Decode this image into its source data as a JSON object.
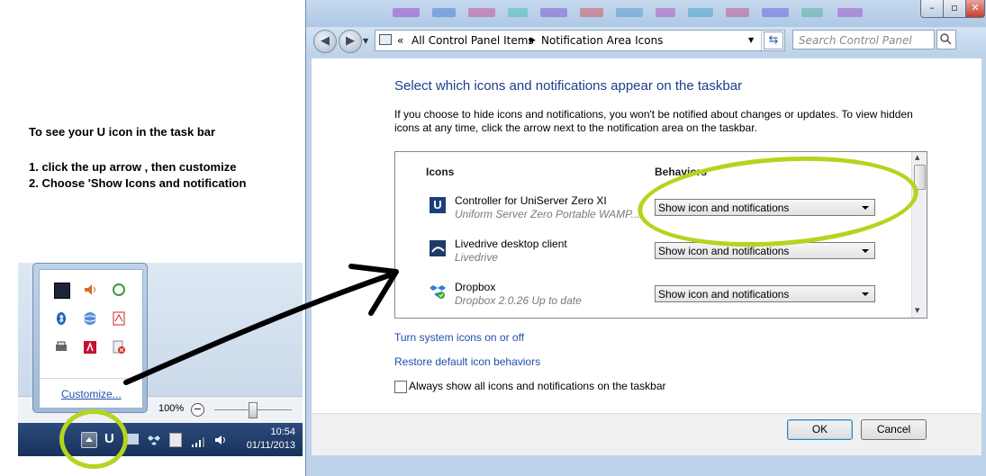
{
  "instructions": {
    "line1": "To see your U icon in the task bar",
    "line2": "1. click the up arrow , then customize",
    "line3": "2. Choose 'Show Icons and notification"
  },
  "window": {
    "breadcrumb": {
      "prefix": "«",
      "items": [
        "All Control Panel Items",
        "Notification Area Icons"
      ]
    },
    "search_placeholder": "Search Control Panel",
    "heading": "Select which icons and notifications appear on the taskbar",
    "description": "If you choose to hide icons and notifications, you won't be notified about changes or updates. To view hidden icons at any time, click the arrow next to the notification area on the taskbar.",
    "columns": {
      "icons": "Icons",
      "behaviors": "Behaviors"
    },
    "apps": [
      {
        "name": "Controller for UniServer Zero XI",
        "sub": "Uniform Server Zero  Portable WAMP...",
        "behavior": "Show icon and notifications",
        "icon": "uniserver-icon"
      },
      {
        "name": "Livedrive desktop client",
        "sub": "Livedrive",
        "behavior": "Show icon and notifications",
        "icon": "livedrive-icon"
      },
      {
        "name": "Dropbox",
        "sub": "Dropbox 2.0.26 Up to date",
        "behavior": "Show icon and notifications",
        "icon": "dropbox-icon"
      }
    ],
    "links": {
      "system_icons": "Turn system icons on or off",
      "restore": "Restore default icon behaviors"
    },
    "always_show_label": "Always show all icons and notifications on the taskbar",
    "ok": "OK",
    "cancel": "Cancel",
    "colors": {
      "heading": "#1e3c8c",
      "link": "#1f4fa8",
      "highlight": "#b5d41e"
    }
  },
  "tray_popup": {
    "customize": "Customize..."
  },
  "zoom": {
    "label": "100%"
  },
  "taskbar": {
    "time": "10:54",
    "date": "01/11/2013",
    "u_label": "U"
  }
}
